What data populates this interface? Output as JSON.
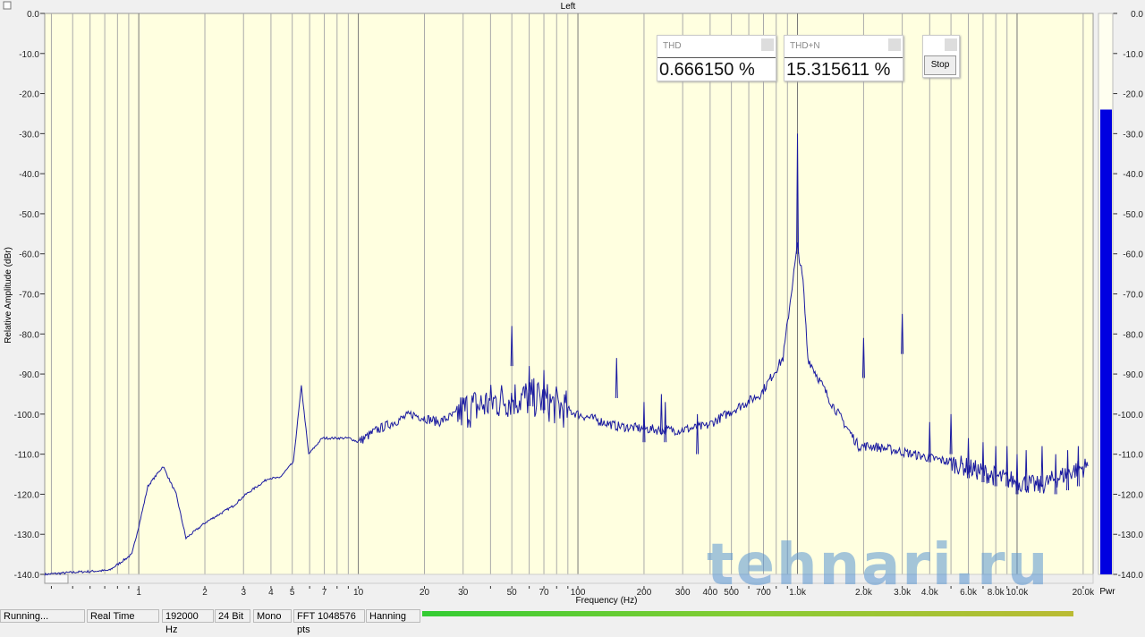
{
  "chart_data": {
    "type": "line",
    "title": "Left",
    "xlabel": "Frequency (Hz)",
    "ylabel": "Relative Amplitude (dBr)",
    "xscale": "log",
    "xlim": [
      0.373,
      22200
    ],
    "ylim": [
      -140,
      0
    ],
    "yticks": [
      "0.0",
      "-10.0",
      "-20.0",
      "-30.0",
      "-40.0",
      "-50.0",
      "-60.0",
      "-70.0",
      "-80.0",
      "-90.0",
      "-100.0",
      "-110.0",
      "-120.0",
      "-130.0",
      "-140.0"
    ],
    "xticks": [
      {
        "v": 1,
        "l": "1"
      },
      {
        "v": 2,
        "l": "2"
      },
      {
        "v": 3,
        "l": "3"
      },
      {
        "v": 4,
        "l": "4"
      },
      {
        "v": 5,
        "l": "5"
      },
      {
        "v": 7,
        "l": "7"
      },
      {
        "v": 10,
        "l": "10"
      },
      {
        "v": 20,
        "l": "20"
      },
      {
        "v": 30,
        "l": "30"
      },
      {
        "v": 50,
        "l": "50"
      },
      {
        "v": 70,
        "l": "70"
      },
      {
        "v": 100,
        "l": "100"
      },
      {
        "v": 200,
        "l": "200"
      },
      {
        "v": 300,
        "l": "300"
      },
      {
        "v": 400,
        "l": "400"
      },
      {
        "v": 500,
        "l": "500"
      },
      {
        "v": 700,
        "l": "700"
      },
      {
        "v": 1000,
        "l": "1.0k"
      },
      {
        "v": 2000,
        "l": "2.0k"
      },
      {
        "v": 3000,
        "l": "3.0k"
      },
      {
        "v": 4000,
        "l": "4.0k"
      },
      {
        "v": 6000,
        "l": "6.0k"
      },
      {
        "v": 8000,
        "l": "8.0k"
      },
      {
        "v": 10000,
        "l": "10.0k"
      },
      {
        "v": 20000,
        "l": "20.0k"
      }
    ],
    "series": [
      {
        "name": "Left",
        "color": "#1a1aa0",
        "points": [
          [
            0.373,
            -140
          ],
          [
            0.5,
            -139.5
          ],
          [
            0.734,
            -139
          ],
          [
            0.93,
            -135
          ],
          [
            1.02,
            -126
          ],
          [
            1.1,
            -118
          ],
          [
            1.29,
            -113
          ],
          [
            1.48,
            -120
          ],
          [
            1.64,
            -131
          ],
          [
            2.02,
            -127
          ],
          [
            2.68,
            -123
          ],
          [
            3.08,
            -120
          ],
          [
            3.9,
            -116
          ],
          [
            4.36,
            -116
          ],
          [
            5.06,
            -112
          ],
          [
            5.5,
            -93
          ],
          [
            5.94,
            -110
          ],
          [
            6.85,
            -106
          ],
          [
            9.1,
            -106
          ],
          [
            10,
            -107
          ],
          [
            12.1,
            -104
          ],
          [
            17.5,
            -100
          ],
          [
            23.2,
            -102
          ],
          [
            30.6,
            -99
          ],
          [
            40.5,
            -97
          ],
          [
            50.3,
            -96
          ],
          [
            64.8,
            -96
          ],
          [
            100,
            -100
          ],
          [
            150,
            -103
          ],
          [
            240,
            -104
          ],
          [
            290,
            -104
          ],
          [
            385,
            -103
          ],
          [
            510,
            -99
          ],
          [
            680,
            -95
          ],
          [
            860,
            -86
          ],
          [
            945,
            -68
          ],
          [
            1000,
            -58
          ],
          [
            1060,
            -67
          ],
          [
            1115,
            -86
          ],
          [
            1420,
            -97
          ],
          [
            1900,
            -108
          ],
          [
            2200,
            -108
          ],
          [
            2760,
            -109
          ],
          [
            3350,
            -110
          ],
          [
            4970,
            -112
          ],
          [
            8550,
            -116
          ],
          [
            12600,
            -118
          ],
          [
            18200,
            -114
          ],
          [
            21000,
            -113
          ]
        ]
      }
    ],
    "spikes": [
      [
        1000,
        -30
      ],
      [
        50,
        -78
      ],
      [
        150,
        -86
      ],
      [
        60,
        -88
      ],
      [
        70,
        -89
      ],
      [
        200,
        -97
      ],
      [
        240,
        -95
      ],
      [
        250,
        -97
      ],
      [
        350,
        -100
      ],
      [
        2000,
        -81
      ],
      [
        3000,
        -75
      ],
      [
        4000,
        -102
      ],
      [
        5000,
        -100
      ],
      [
        6000,
        -106
      ],
      [
        7000,
        -107
      ],
      [
        8000,
        -108
      ],
      [
        9000,
        -108
      ],
      [
        10000,
        -110
      ],
      [
        11000,
        -109
      ],
      [
        13000,
        -108
      ],
      [
        15000,
        -110
      ],
      [
        17000,
        -109
      ],
      [
        19000,
        -108
      ]
    ],
    "power_meter": {
      "label": "Pwr",
      "level_db": -24
    }
  },
  "thd": {
    "label": "THD",
    "value": "0.666150 %"
  },
  "thdn": {
    "label": "THD+N",
    "value": "15.315611 %"
  },
  "stop_label": "Stop",
  "status": {
    "state": "Running...",
    "mode": "Real Time",
    "rate": "192000 Hz",
    "bits": "24 Bit",
    "channels": "Mono",
    "fft": "FFT 1048576 pts",
    "window": "Hanning"
  },
  "watermark": "tehnari.ru"
}
